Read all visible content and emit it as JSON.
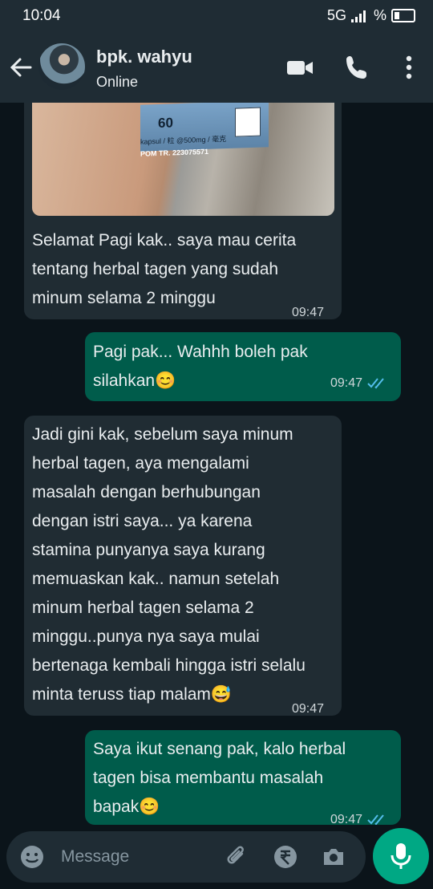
{
  "status_bar": {
    "time": "10:04",
    "network": "5G",
    "battery_symbol": "%"
  },
  "header": {
    "contact_name": "bpk. wahyu",
    "status": "Online"
  },
  "photo": {
    "box_count": "60",
    "box_label": "kapsul / 粒 @500mg / 毫克",
    "box_reg": "POM TR. 223075571"
  },
  "messages": [
    {
      "direction": "in",
      "lines": [
        " Selamat Pagi kak.. saya mau cerita",
        "tentang herbal tagen yang sudah",
        "minum selama 2 minggu"
      ],
      "time": "09:47"
    },
    {
      "direction": "out",
      "lines": [
        " Pagi pak... Wahhh boleh pak",
        "silahkan😊"
      ],
      "time": "09:47",
      "read": true
    },
    {
      "direction": "in",
      "lines": [
        " Jadi gini kak, sebelum saya minum",
        "herbal tagen, aya mengalami",
        "masalah dengan berhubungan",
        "dengan istri saya... ya karena",
        "stamina punyanya saya kurang",
        "memuaskan kak.. namun setelah",
        "minum herbal tagen selama 2",
        "minggu..punya nya saya mulai",
        "bertenaga kembali hingga istri selalu",
        "minta teruss tiap malam😅"
      ],
      "time": "09:47"
    },
    {
      "direction": "out",
      "lines": [
        " Saya ikut senang pak, kalo herbal",
        "tagen bisa  membantu masalah",
        "bapak😊"
      ],
      "time": "09:47",
      "read": true
    }
  ],
  "input": {
    "placeholder": "Message"
  },
  "icons": {
    "back": "arrow-left-icon",
    "video": "video-call-icon",
    "call": "phone-icon",
    "menu": "more-vert-icon",
    "emoji": "emoji-icon",
    "attach": "paperclip-icon",
    "payment": "rupee-icon",
    "camera": "camera-icon",
    "mic": "mic-icon"
  },
  "colors": {
    "app_bar": "#1f2c34",
    "background": "#0b141a",
    "incoming_bubble": "#202c33",
    "outgoing_bubble": "#005c4b",
    "accent": "#00a884",
    "read_ticks": "#53bdeb"
  }
}
